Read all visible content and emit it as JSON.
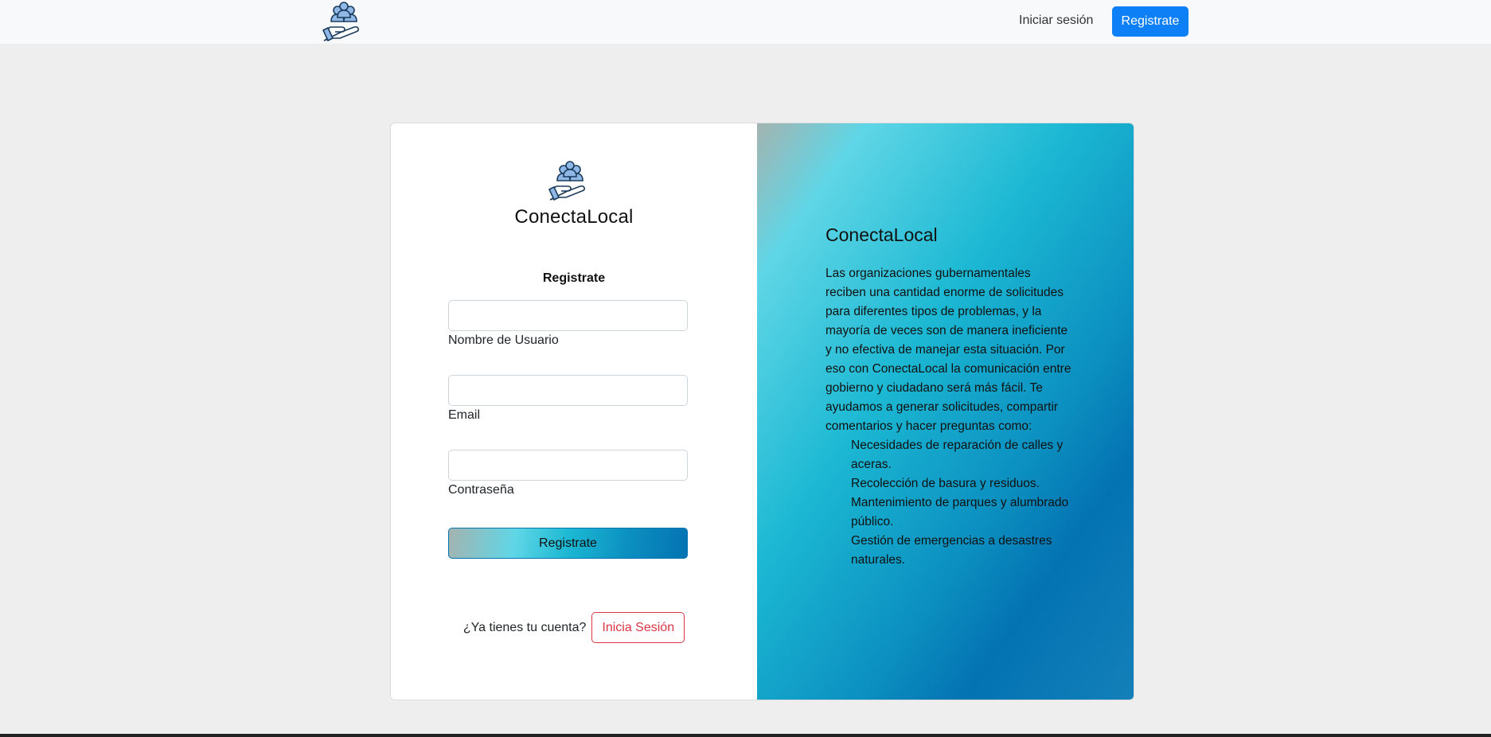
{
  "navbar": {
    "logo_icon": "people-in-hand-icon",
    "login_link": "Iniciar sesión",
    "register_button": "Registrate"
  },
  "form": {
    "logo_icon": "people-in-hand-icon",
    "brand": "ConectaLocal",
    "title": "Registrate",
    "fields": [
      {
        "label": "Nombre de Usuario",
        "value": "",
        "placeholder": ""
      },
      {
        "label": "Email",
        "value": "",
        "placeholder": ""
      },
      {
        "label": "Contraseña",
        "value": "",
        "placeholder": ""
      }
    ],
    "submit_label": "Registrate",
    "login_prompt": "¿Ya tienes tu cuenta?",
    "login_button": "Inicia Sesión"
  },
  "info": {
    "title": "ConectaLocal",
    "description": "Las organizaciones gubernamentales reciben una cantidad enorme de solicitudes para diferentes tipos de problemas, y la mayoría de veces son de manera ineficiente y no efectiva de manejar esta situación. Por eso con ConectaLocal la comunicación entre gobierno y ciudadano será más fácil. Te ayudamos a generar solicitudes, compartir comentarios y hacer preguntas como:",
    "items": [
      "Necesidades de reparación de calles y aceras.",
      "Recolección de basura y residuos.",
      "Mantenimiento de parques y alumbrado público.",
      "Gestión de emergencias a desastres naturales."
    ]
  },
  "colors": {
    "primary": "#0d80f8",
    "danger": "#dc3545",
    "gradient_start": "#a4b3b0",
    "gradient_mid": "#5fd6e6",
    "gradient_end": "#0473b2",
    "background": "#eeeeee"
  }
}
